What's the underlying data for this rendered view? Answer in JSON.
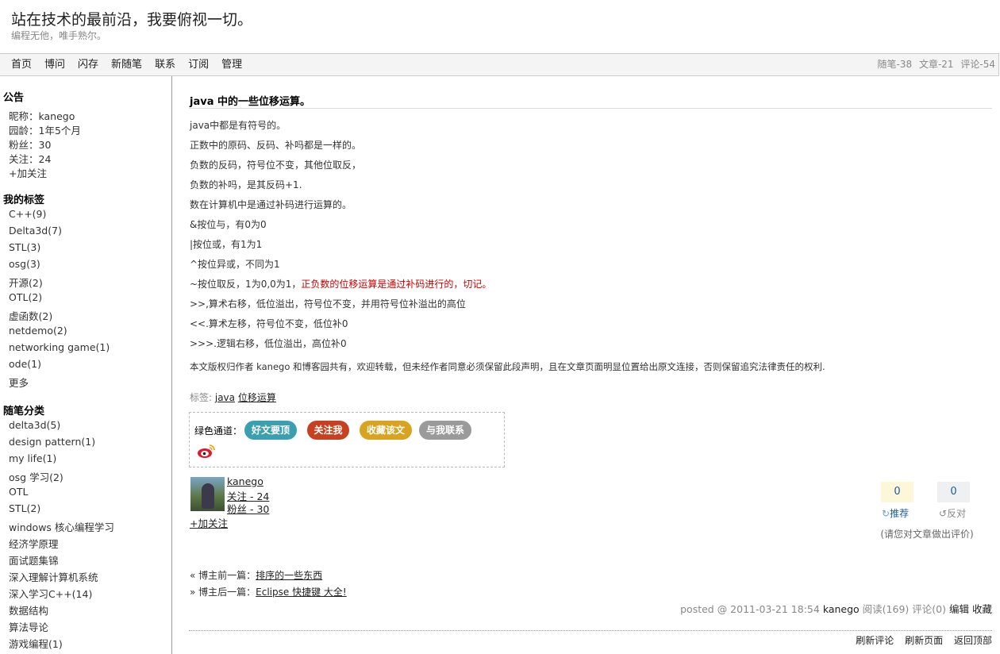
{
  "header": {
    "title": "站在技术的最前沿，我要俯视一切。",
    "subtitle": "编程无他，唯手熟尔。"
  },
  "nav": {
    "items": [
      "首页",
      "博问",
      "闪存",
      "新随笔",
      "联系",
      "订阅",
      "管理"
    ],
    "stats": [
      "随笔-38",
      "文章-21",
      "评论-54"
    ]
  },
  "sidebar": {
    "notice": {
      "heading": "公告",
      "nickname": "昵称：kanego",
      "age": "园龄：1年5个月",
      "fans": "粉丝：30",
      "following": "关注：24",
      "follow_link": "+加关注"
    },
    "tags": {
      "heading": "我的标签",
      "items": [
        "C++(9)",
        "Delta3d(7)",
        "STL(3)",
        "osg(3)",
        "开源(2)",
        "OTL(2)",
        "虚函数(2)",
        "netdemo(2)",
        "networking game(1)",
        "ode(1)",
        "更多"
      ]
    },
    "categories": {
      "heading": "随笔分类",
      "items": [
        "delta3d(5)",
        "design pattern(1)",
        "my life(1)",
        "osg 学习(2)",
        "OTL",
        "STL(2)",
        "windows 核心编程学习",
        "经济学原理",
        "面试题集锦",
        "深入理解计算机系统",
        "深入学习C++(14)",
        "数据结构",
        "算法导论",
        "游戏编程(1)"
      ]
    }
  },
  "post": {
    "title": "java 中的一些位移运算。",
    "lines": [
      "java中都是有符号的。",
      "正数中的原码、反码、补吗都是一样的。",
      "负数的反码，符号位不变，其他位取反，",
      "负数的补吗，是其反码+1.",
      "数在计算机中是通过补码进行运算的。",
      "&按位与，有0为0",
      "|按位或，有1为1",
      "^按位异或，不同为1"
    ],
    "line_not": "~按位取反，1为0,0为1，",
    "line_not_red": "正负数的位移运算是通过补码进行的，切记。",
    "lines2": [
      ">>,算术右移，低位溢出，符号位不变，并用符号位补溢出的高位",
      "<<.算术左移，符号位不变，低位补0",
      ">>>.逻辑右移，低位溢出，高位补0"
    ],
    "copyright": "本文版权归作者 kanego 和博客园共有，欢迎转载，但未经作者同意必须保留此段声明，且在文章页面明显位置给出原文连接，否则保留追究法律责任的权利.",
    "tags_label": "标签: ",
    "tags": [
      "java",
      "位移运算"
    ]
  },
  "share": {
    "label": "绿色通道：",
    "buttons": [
      {
        "label": "好文要顶",
        "color": "#3aa0b0"
      },
      {
        "label": "关注我",
        "color": "#c8401f"
      },
      {
        "label": "收藏该文",
        "color": "#d9a320"
      },
      {
        "label": "与我联系",
        "color": "#9a9a9a"
      }
    ]
  },
  "author": {
    "name": "kanego",
    "following": "关注 - 24",
    "fans": "粉丝 - 30",
    "follow_link": "+加关注"
  },
  "votes": {
    "digg_count": "0",
    "digg_label": "推荐",
    "bury_count": "0",
    "bury_label": "反对",
    "note": "(请您对文章做出评价)"
  },
  "prev_next": {
    "prev_prefix": "« 博主前一篇：",
    "prev_title": "排序的一些东西",
    "next_prefix": "» 博主后一篇：",
    "next_title": "Eclipse 快捷键 大全!"
  },
  "post_info": {
    "posted": "posted @ 2011-03-21 18:54",
    "author": "kanego",
    "reads": "阅读(169)",
    "comments": "评论(0)",
    "edit": "编辑",
    "favorite": "收藏"
  },
  "footer_links": [
    "刷新评论",
    "刷新页面",
    "返回顶部"
  ]
}
